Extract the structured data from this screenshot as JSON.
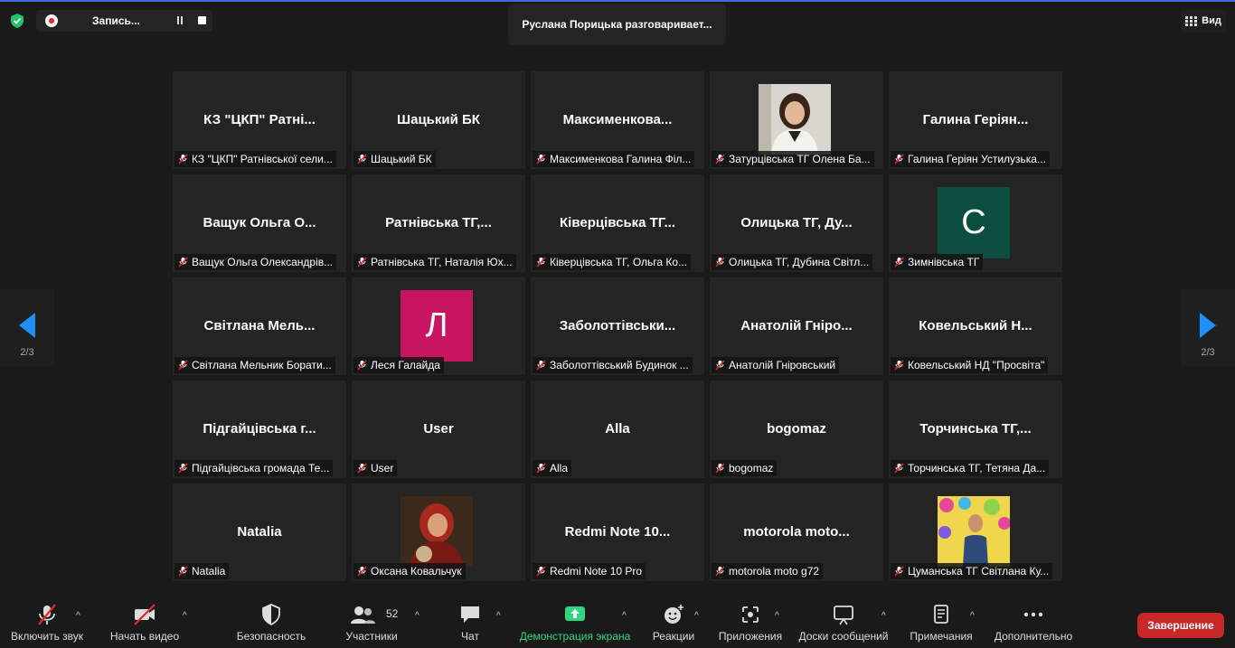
{
  "top": {
    "recording_label": "Запись...",
    "speaker_banner": "Руслана Порицька разговаривает...",
    "view_label": "Вид",
    "page_left": "2/3",
    "page_right": "2/3"
  },
  "tiles": [
    {
      "name": "КЗ \"ЦКП\" Ратні...",
      "label": "КЗ \"ЦКП\" Ратнівської сели..."
    },
    {
      "name": "Шацький БК",
      "label": "Шацький БК"
    },
    {
      "name": "Максименкова...",
      "label": "Максименкова Галина Філ..."
    },
    {
      "name": "",
      "label": "Затурцівська ТГ Олена Ба..."
    },
    {
      "name": "Галина Геріян...",
      "label": "Галина Геріян Устилузька..."
    },
    {
      "name": "Ващук Ольга О...",
      "label": "Ващук Ольга Олександрів..."
    },
    {
      "name": "Ратнівська ТГ,...",
      "label": "Ратнівська ТГ, Наталія Юх..."
    },
    {
      "name": "Ківерцівська ТГ...",
      "label": "Ківерцівська ТГ, Ольга Ко..."
    },
    {
      "name": "Олицька ТГ, Ду...",
      "label": "Олицька ТГ, Дубина Світл..."
    },
    {
      "name": "",
      "avatar": "С",
      "label": "Зимнівська ТГ"
    },
    {
      "name": "Світлана Мель...",
      "label": "Світлана Мельник Борати..."
    },
    {
      "name": "",
      "avatar": "Л",
      "label": "Леся Галайда"
    },
    {
      "name": "Заболоттівськи...",
      "label": "Заболоттівський Будинок ..."
    },
    {
      "name": "Анатолій Гніро...",
      "label": "Анатолій Гніровський"
    },
    {
      "name": "Ковельський Н...",
      "label": "Ковельський НД \"Просвіта\""
    },
    {
      "name": "Підгайцівська г...",
      "label": "Підгайцівська громада Те..."
    },
    {
      "name": "User",
      "label": "User"
    },
    {
      "name": "Alla",
      "label": "Alla"
    },
    {
      "name": "bogomaz",
      "label": "bogomaz"
    },
    {
      "name": "Торчинська ТГ,...",
      "label": "Торчинська ТГ, Тетяна Да..."
    },
    {
      "name": "Natalia",
      "label": "Natalia"
    },
    {
      "name": "",
      "label": "Оксана Ковальчук"
    },
    {
      "name": "Redmi Note 10...",
      "label": "Redmi Note 10 Pro"
    },
    {
      "name": "motorola moto...",
      "label": "motorola moto g72"
    },
    {
      "name": "",
      "label": "Цуманська ТГ Світлана Ку..."
    }
  ],
  "toolbar": {
    "audio": "Включить звук",
    "video": "Начать видео",
    "security": "Безопасность",
    "participants": "Участники",
    "participants_count": "52",
    "chat": "Чат",
    "share": "Демонстрация экрана",
    "reactions": "Реакции",
    "apps": "Приложения",
    "whiteboards": "Доски сообщений",
    "notes": "Примечания",
    "more": "Дополнительно",
    "end": "Завершение"
  },
  "colors": {
    "background": "#1a1a1a",
    "tile": "#242424",
    "avatar_c": "#0b4d3f",
    "avatar_l": "#c7155f",
    "share_green": "#2fd67c",
    "end_red": "#c72828",
    "nav_blue": "#1e8ff6"
  }
}
